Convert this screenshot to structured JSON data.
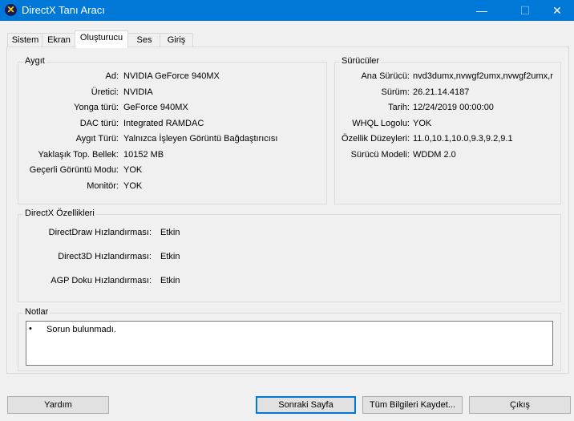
{
  "window": {
    "title": "DirectX Tanı Aracı",
    "minimize": "—",
    "maximize": "☐",
    "close": "✕"
  },
  "tabs": [
    {
      "label": "Sistem"
    },
    {
      "label": "Ekran"
    },
    {
      "label": "Oluşturucu",
      "active": true
    },
    {
      "label": "Ses"
    },
    {
      "label": "Giriş"
    }
  ],
  "device": {
    "title": "Aygıt",
    "rows": [
      {
        "label": "Ad:",
        "value": "NVIDIA GeForce 940MX"
      },
      {
        "label": "Üretici:",
        "value": "NVIDIA"
      },
      {
        "label": "Yonga türü:",
        "value": "GeForce 940MX"
      },
      {
        "label": "DAC türü:",
        "value": "Integrated RAMDAC"
      },
      {
        "label": "Aygıt Türü:",
        "value": "Yalnızca İşleyen Görüntü Bağdaştırıcısı"
      },
      {
        "label": "Yaklaşık Top. Bellek:",
        "value": "10152 MB"
      },
      {
        "label": "Geçerli Görüntü Modu:",
        "value": "YOK"
      },
      {
        "label": "Monitör:",
        "value": "YOK"
      }
    ]
  },
  "drivers": {
    "title": "Sürücüler",
    "rows": [
      {
        "label": "Ana Sürücü:",
        "value": "nvd3dumx,nvwgf2umx,nvwgf2umx,r"
      },
      {
        "label": "Sürüm:",
        "value": "26.21.14.4187"
      },
      {
        "label": "Tarih:",
        "value": "12/24/2019 00:00:00"
      },
      {
        "label": "WHQL Logolu:",
        "value": "YOK"
      },
      {
        "label": "Özellik Düzeyleri:",
        "value": "11.0,10.1,10.0,9.3,9.2,9.1"
      },
      {
        "label": "Sürücü Modeli:",
        "value": "WDDM 2.0"
      }
    ]
  },
  "features": {
    "title": "DirectX Özellikleri",
    "rows": [
      {
        "label": "DirectDraw Hızlandırması:",
        "value": "Etkin"
      },
      {
        "label": "Direct3D Hızlandırması:",
        "value": "Etkin"
      },
      {
        "label": "AGP Doku Hızlandırması:",
        "value": "Etkin"
      }
    ]
  },
  "notes": {
    "title": "Notlar",
    "items": [
      "Sorun bulunmadı."
    ]
  },
  "buttons": {
    "help": "Yardım",
    "next": "Sonraki Sayfa",
    "save": "Tüm Bilgileri Kaydet...",
    "exit": "Çıkış"
  }
}
